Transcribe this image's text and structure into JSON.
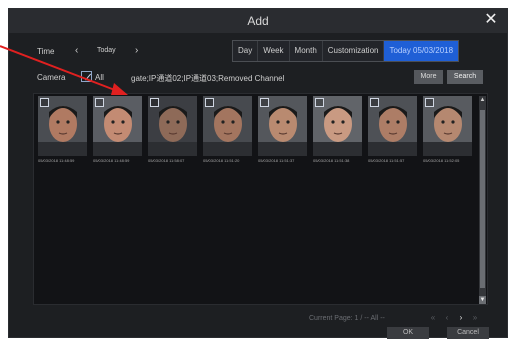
{
  "window": {
    "title": "Add",
    "close_glyph": "✕"
  },
  "time_row": {
    "label": "Time",
    "prev_glyph": "‹",
    "today": "Today",
    "next_glyph": "›",
    "tabs": [
      "Day",
      "Week",
      "Month",
      "Customization",
      "Today 05/03/2018"
    ],
    "active_tab": 4
  },
  "camera_row": {
    "label": "Camera",
    "all_checked": true,
    "all_label": "All",
    "channels": "gate;IP通道02;IP通道03;Removed Channel",
    "more_label": "More",
    "search_label": "Search"
  },
  "results": {
    "thumbnails": [
      {
        "timestamp": "05/03/2018 11:48:59",
        "checked": false
      },
      {
        "timestamp": "05/03/2018 11:48:59",
        "checked": false
      },
      {
        "timestamp": "05/03/2018 11:58:07",
        "checked": false
      },
      {
        "timestamp": "05/03/2018 11:51:20",
        "checked": false
      },
      {
        "timestamp": "05/03/2018 11:51:37",
        "checked": false
      },
      {
        "timestamp": "05/03/2018 11:51:38",
        "checked": false
      },
      {
        "timestamp": "05/03/2018 11:51:57",
        "checked": false
      },
      {
        "timestamp": "05/03/2018 11:52:05",
        "checked": false
      }
    ]
  },
  "pagination": {
    "text": "Current Page: 1 / -- All --",
    "arrows": [
      "«",
      "‹",
      "›",
      "»"
    ],
    "active_arrow": 2
  },
  "footer": {
    "ok_label": "OK",
    "cancel_label": "Cancel"
  },
  "colors": {
    "dialog_bg": "#1d1f22",
    "accent": "#1f5fd6",
    "annotation_arrow": "#e02020"
  }
}
